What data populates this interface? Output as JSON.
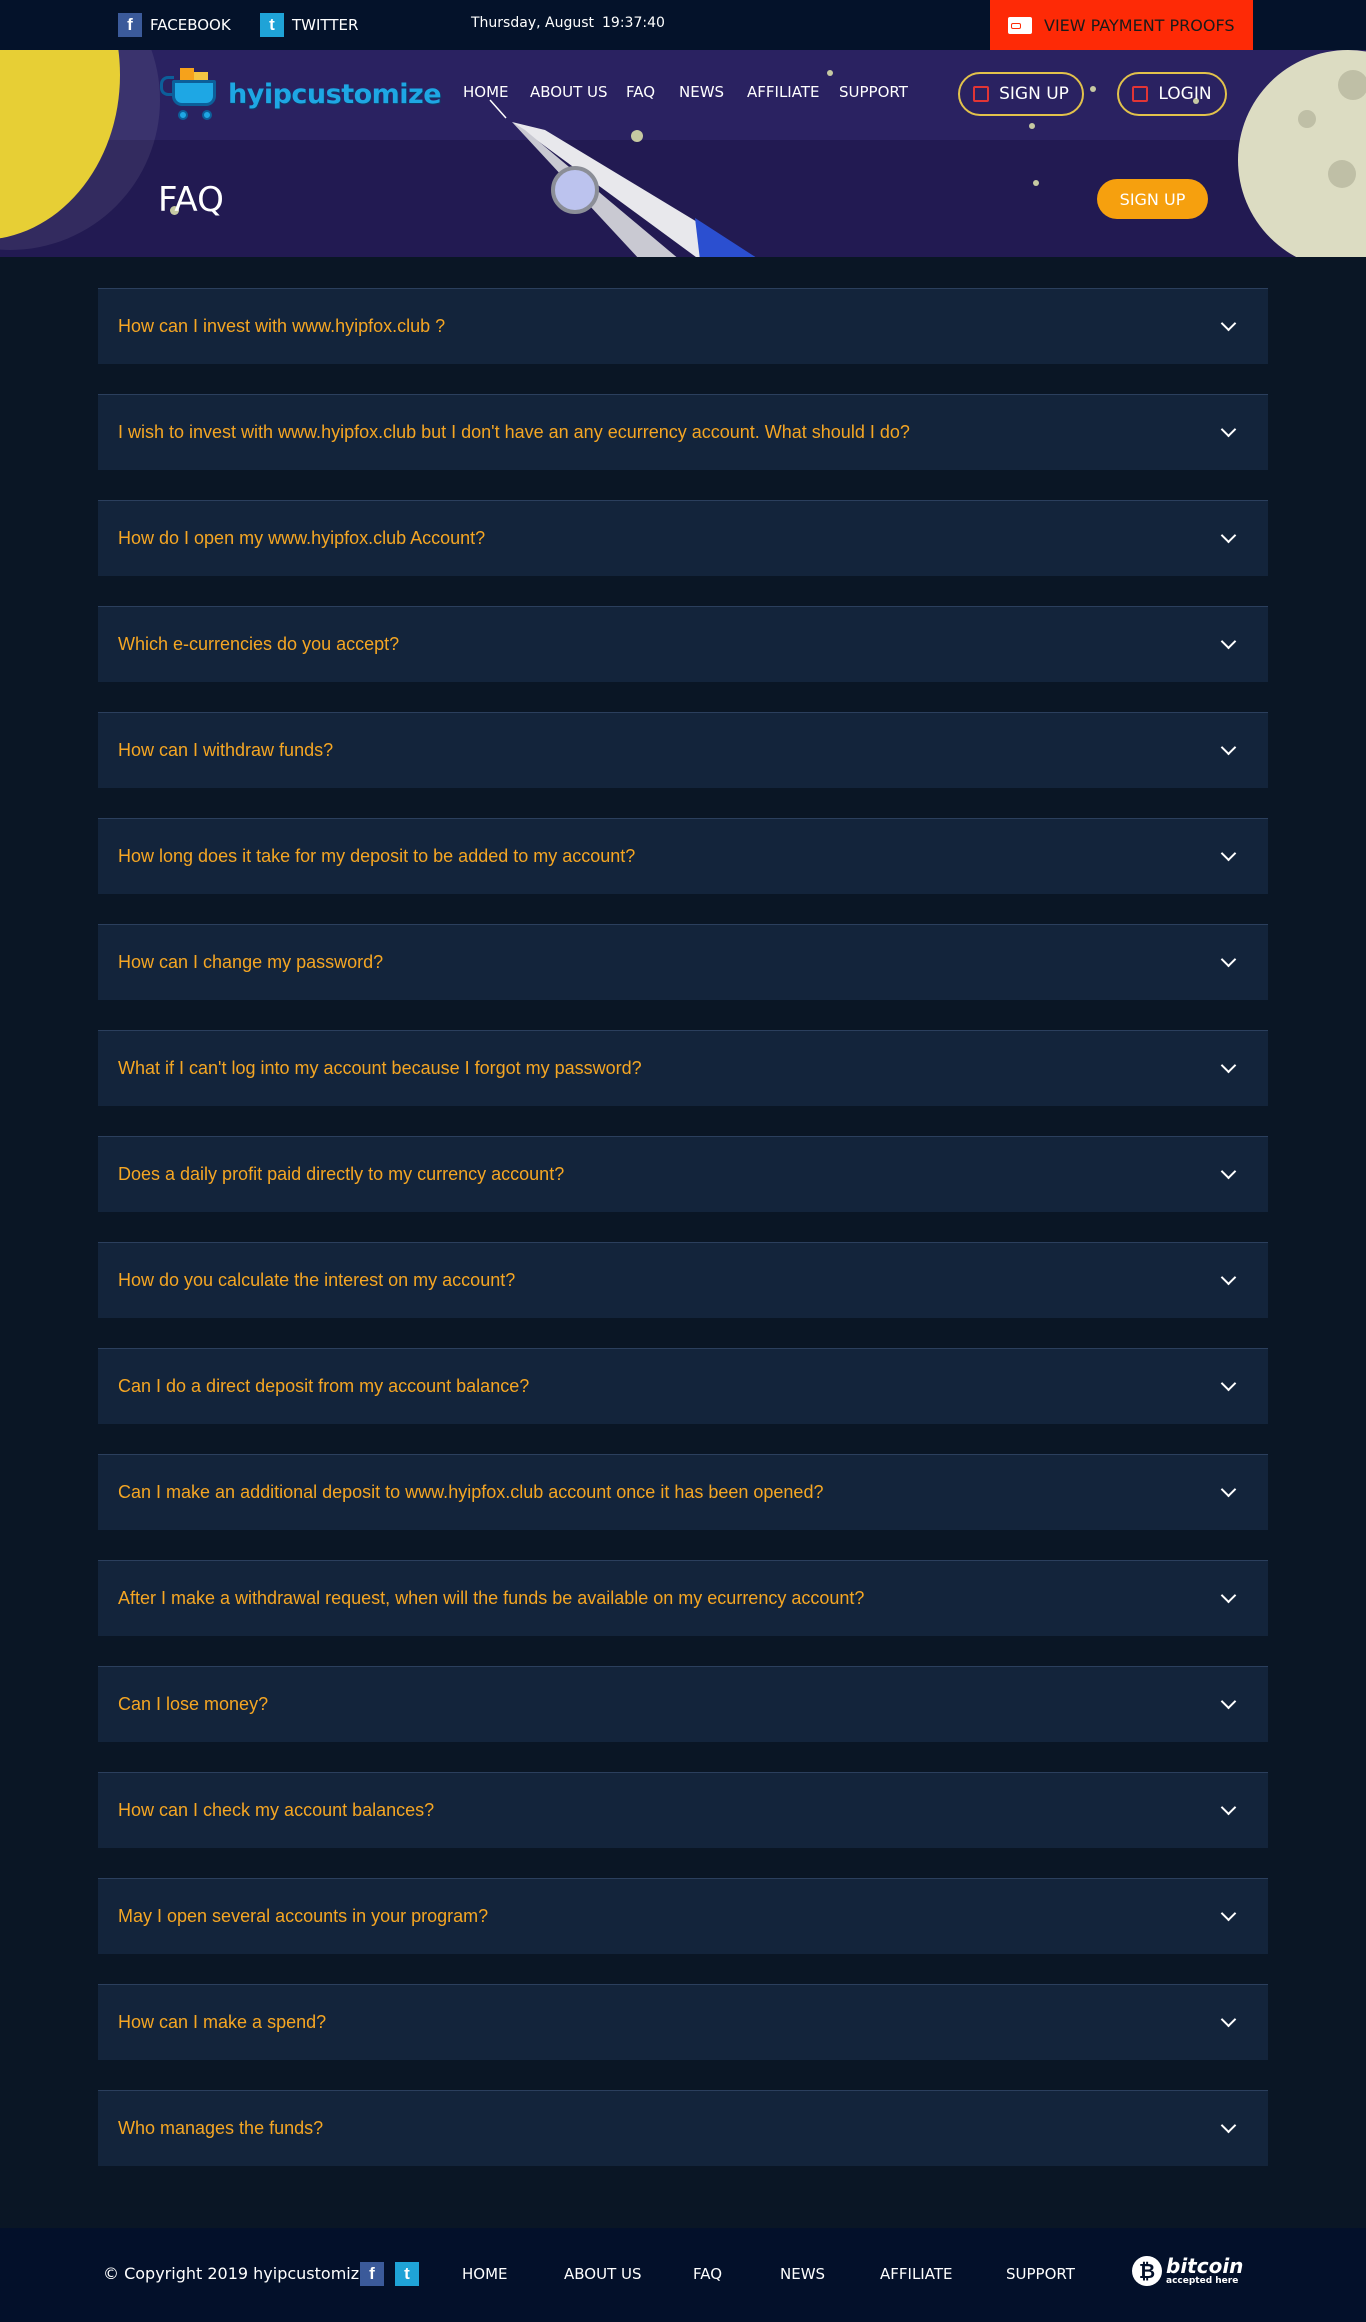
{
  "topbar": {
    "facebook_label": "FACEBOOK",
    "twitter_label": "TWITTER",
    "date": "Thursday, August",
    "time": "19:37:40",
    "payment_proofs_label": "VIEW PAYMENT PROOFS"
  },
  "header": {
    "logo_text": "hyipcustomize",
    "nav": [
      "HOME",
      "ABOUT US",
      "FAQ",
      "NEWS",
      "AFFILIATE",
      "SUPPORT"
    ],
    "signup_label": "SIGN UP",
    "login_label": "LOGIN"
  },
  "hero": {
    "title": "FAQ",
    "signup_label": "SIGN UP"
  },
  "faq": [
    "How can I invest with www.hyipfox.club ?",
    "I wish to invest with www.hyipfox.club but I don't have an any ecurrency account. What should I do?",
    "How do I open my www.hyipfox.club Account?",
    "Which e-currencies do you accept?",
    "How can I withdraw funds?",
    "How long does it take for my deposit to be added to my account?",
    "How can I change my password?",
    "What if I can't log into my account because I forgot my password?",
    "Does a daily profit paid directly to my currency account?",
    "How do you calculate the interest on my account?",
    "Can I do a direct deposit from my account balance?",
    "Can I make an additional deposit to www.hyipfox.club account once it has been opened?",
    "After I make a withdrawal request, when will the funds be available on my ecurrency account?",
    "Can I lose money?",
    "How can I check my account balances?",
    "May I open several accounts in your program?",
    "How can I make a spend?",
    "Who manages the funds?"
  ],
  "footer": {
    "copyright": "© Copyright 2019 hyipcustomize",
    "nav": [
      "HOME",
      "ABOUT US",
      "FAQ",
      "NEWS",
      "AFFILIATE",
      "SUPPORT"
    ],
    "bitcoin_word": "bitcoin",
    "bitcoin_sub": "accepted here"
  },
  "colors": {
    "accent_orange": "#f5a623",
    "proofs_red": "#fe2a06",
    "hero_purple": "#221a52",
    "page_bg": "#0a1625",
    "faq_bg": "#13243b"
  },
  "icons": [
    "facebook-icon",
    "twitter-icon",
    "card-icon",
    "chevron-down-icon",
    "signup-icon",
    "login-icon",
    "bitcoin-icon"
  ]
}
